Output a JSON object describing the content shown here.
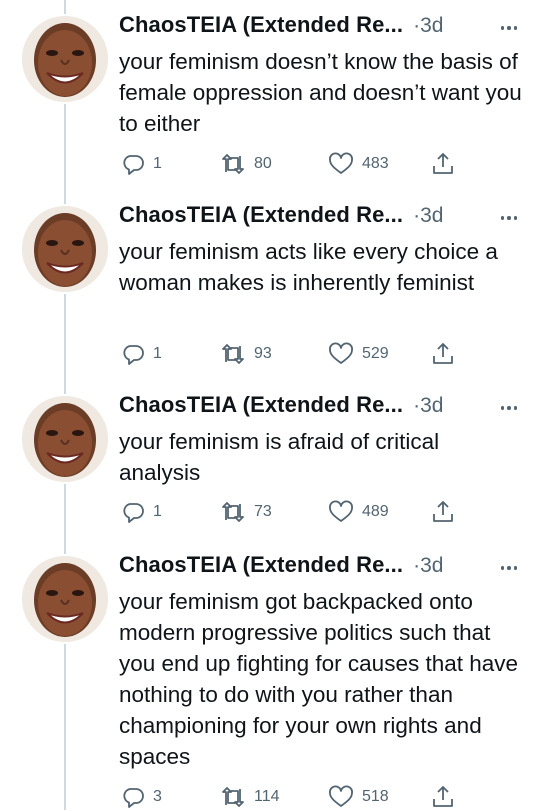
{
  "tweets": [
    {
      "author": "ChaosTEIA (Extended Re...",
      "time_sep": "·",
      "time": "3d",
      "text": "your feminism doesn’t know the basis of female oppression and doesn’t want you to either",
      "replies": "1",
      "retweets": "80",
      "likes": "483"
    },
    {
      "author": "ChaosTEIA (Extended Re...",
      "time_sep": "·",
      "time": "3d",
      "text": "your feminism acts like every choice a woman makes is inherently feminist",
      "replies": "1",
      "retweets": "93",
      "likes": "529"
    },
    {
      "author": "ChaosTEIA (Extended Re...",
      "time_sep": "·",
      "time": "3d",
      "text": "your feminism is afraid of critical analysis",
      "replies": "1",
      "retweets": "73",
      "likes": "489"
    },
    {
      "author": "ChaosTEIA (Extended Re...",
      "time_sep": "·",
      "time": "3d",
      "text": "your feminism got backpacked onto modern progressive politics such that you end up fighting for causes that have nothing to do with you rather than championing for your own rights and spaces",
      "replies": "3",
      "retweets": "114",
      "likes": "518"
    }
  ],
  "icons": {
    "reply": "reply-icon",
    "retweet": "retweet-icon",
    "like": "heart-icon",
    "share": "share-icon",
    "more": "more-icon",
    "avatar": "avatar"
  },
  "colors": {
    "text": "#0f1419",
    "secondary": "#536471",
    "thread_line": "#cfd9de"
  }
}
